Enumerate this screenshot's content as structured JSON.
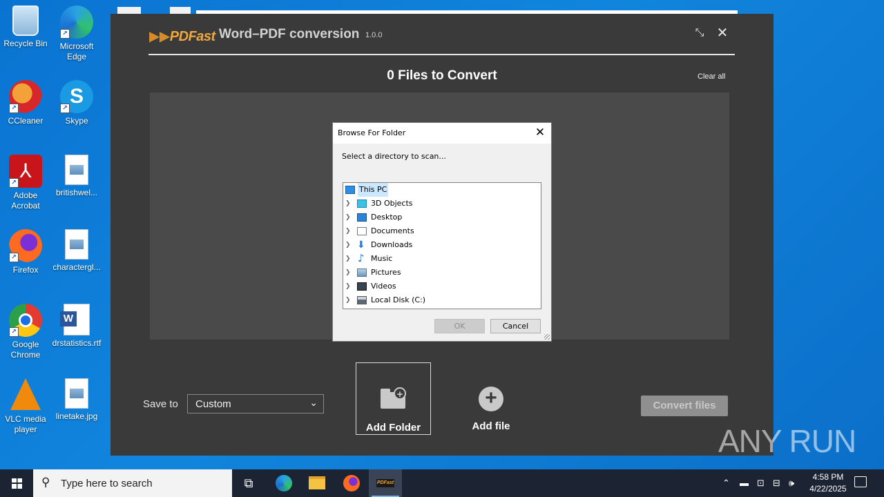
{
  "desktop": {
    "icons": [
      {
        "label": "Recycle Bin"
      },
      {
        "label": "Microsoft Edge"
      },
      {
        "label": "CCleaner"
      },
      {
        "label": "Skype"
      },
      {
        "label": "Adobe Acrobat"
      },
      {
        "label": "britishwel..."
      },
      {
        "label": "Firefox"
      },
      {
        "label": "charactergl..."
      },
      {
        "label": "Google Chrome"
      },
      {
        "label": "drstatistics.rtf"
      },
      {
        "label": "VLC media player"
      },
      {
        "label": "linetake.jpg"
      }
    ]
  },
  "app": {
    "logo": "PDFast",
    "title": "Word–PDF conversion",
    "version": "1.0.0",
    "files_count": "0 Files to Convert",
    "clear_all": "Clear all",
    "save_to_label": "Save to",
    "save_to_value": "Custom",
    "add_folder_label": "Add Folder",
    "add_file_label": "Add file",
    "convert_label": "Convert files",
    "accent_color": "#f0a73c"
  },
  "dialog": {
    "title": "Browse For Folder",
    "prompt": "Select a directory to scan...",
    "tree_root": "This PC",
    "tree_items": [
      "3D Objects",
      "Desktop",
      "Documents",
      "Downloads",
      "Music",
      "Pictures",
      "Videos",
      "Local Disk (C:)"
    ],
    "ok_label": "OK",
    "cancel_label": "Cancel"
  },
  "watermark": "ANY RUN",
  "taskbar": {
    "search_placeholder": "Type here to search",
    "pinned": [
      "task-view-icon",
      "edge-icon",
      "file-explorer-icon",
      "firefox-icon",
      "pdfast-icon"
    ],
    "time": "4:58 PM",
    "date": "4/22/2025"
  }
}
